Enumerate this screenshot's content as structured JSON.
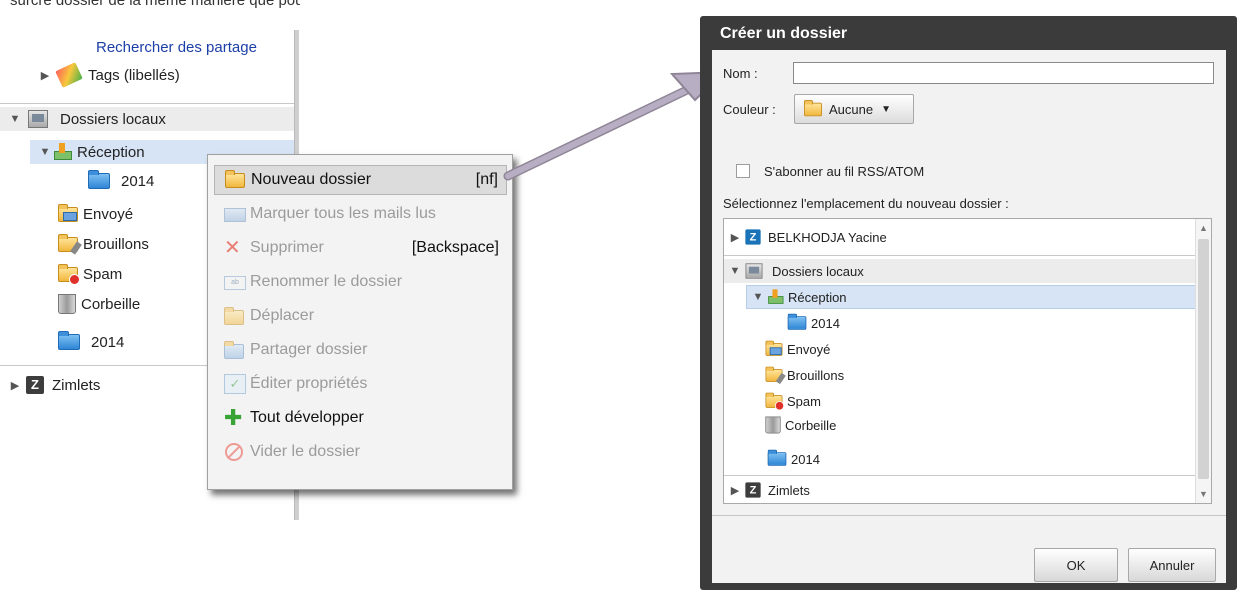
{
  "caption_fragment": "surcre dossier de la meme manière que pour",
  "tree": {
    "search_shares": "Rechercher des partage",
    "tags": "Tags (libellés)",
    "local_folders": "Dossiers locaux",
    "inbox": "Réception",
    "sub_2014": "2014",
    "sent": "Envoyé",
    "drafts": "Brouillons",
    "spam": "Spam",
    "trash": "Corbeille",
    "folder_2014": "2014",
    "zimlets": "Zimlets",
    "zimlets_icon_letter": "Z"
  },
  "context_menu": {
    "items": [
      {
        "label": "Nouveau dossier",
        "shortcut": "[nf]",
        "icon": "new-folder-icon",
        "state": "active"
      },
      {
        "label": "Marquer tous les mails lus",
        "shortcut": "",
        "icon": "mark-read-icon",
        "state": "disabled"
      },
      {
        "label": "Supprimer",
        "shortcut": "[Backspace]",
        "icon": "delete-icon",
        "state": "disabled"
      },
      {
        "label": "Renommer le dossier",
        "shortcut": "",
        "icon": "rename-icon",
        "state": "disabled"
      },
      {
        "label": "Déplacer",
        "shortcut": "",
        "icon": "move-icon",
        "state": "disabled"
      },
      {
        "label": "Partager dossier",
        "shortcut": "",
        "icon": "share-icon",
        "state": "disabled"
      },
      {
        "label": "Éditer propriétés",
        "shortcut": "",
        "icon": "edit-props-icon",
        "state": "disabled"
      },
      {
        "label": "Tout développer",
        "shortcut": "",
        "icon": "plus-icon",
        "state": "enabled"
      },
      {
        "label": "Vider le dossier",
        "shortcut": "",
        "icon": "empty-icon",
        "state": "disabled"
      }
    ]
  },
  "dialog": {
    "title": "Créer un dossier",
    "name_label": "Nom :",
    "name_value": "",
    "color_label": "Couleur :",
    "color_value": "Aucune",
    "rss_label": "S'abonner au fil RSS/ATOM",
    "location_label": "Sélectionnez l'emplacement du nouveau dossier :",
    "tree": {
      "account": "BELKHODJA Yacine",
      "account_icon_letter": "Z",
      "local_folders": "Dossiers locaux",
      "inbox": "Réception",
      "sub_2014": "2014",
      "sent": "Envoyé",
      "drafts": "Brouillons",
      "spam": "Spam",
      "trash": "Corbeille",
      "folder_2014": "2014",
      "zimlets": "Zimlets",
      "zimlets_icon_letter": "Z"
    },
    "ok_label": "OK",
    "cancel_label": "Annuler"
  },
  "colors": {
    "selection": "#d6e4f5",
    "dialog_frame": "#3b3b3b",
    "arrow": "#b8aec4"
  }
}
